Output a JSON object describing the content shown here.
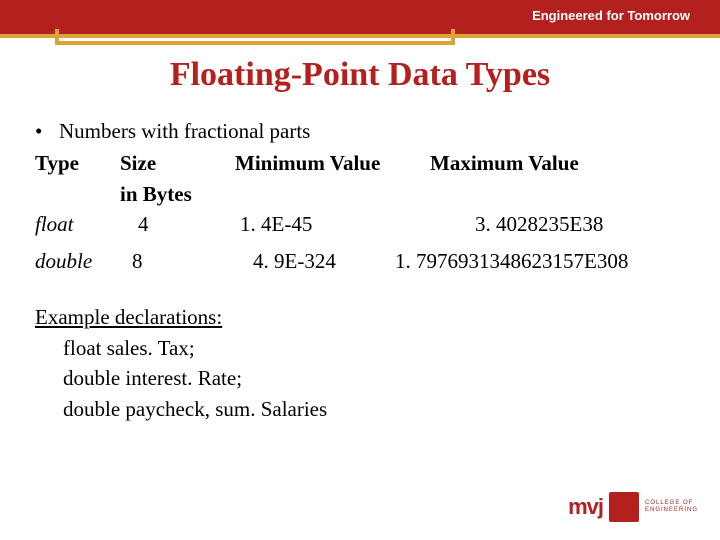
{
  "header": {
    "tagline": "Engineered for Tomorrow"
  },
  "title": "Floating-Point Data Types",
  "bullet_intro": "Numbers with fractional parts",
  "table": {
    "headers": {
      "type": "Type",
      "size_line1": "Size",
      "size_line2": "in Bytes",
      "min": "Minimum Value",
      "max": "Maximum Value"
    },
    "rows": [
      {
        "type": "float",
        "size": "4",
        "min": "1. 4E-45",
        "max": "3. 4028235E38"
      },
      {
        "type": "double",
        "size": "8",
        "min": "4. 9E-324",
        "max": "1. 7976931348623157E308"
      }
    ]
  },
  "example": {
    "heading": "Example declarations:",
    "lines": [
      "float sales. Tax;",
      "double interest. Rate;",
      "double paycheck, sum. Salaries"
    ]
  },
  "footer": {
    "logo": "mvj",
    "logo_sub1": "COLLEGE OF",
    "logo_sub2": "ENGINEERING"
  }
}
